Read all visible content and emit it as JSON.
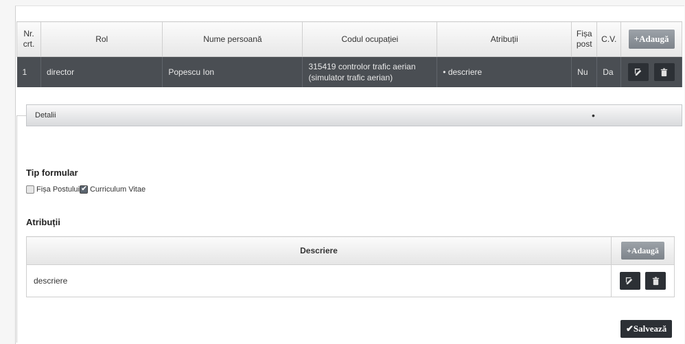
{
  "table": {
    "headers": {
      "nr": "Nr. crt.",
      "rol": "Rol",
      "nume": "Nume persoană",
      "cod": "Codul ocupației",
      "atributii": "Atribuții",
      "fisa": "Fișa post",
      "cv": "C.V."
    },
    "add_label": "+Adaugă",
    "rows": [
      {
        "nr": "1",
        "rol": "director",
        "nume": "Popescu Ion",
        "cod": "315419 controlor trafic aerian (simulator trafic aerian)",
        "atributii": "• descriere",
        "fisa": "Nu",
        "cv": "Da"
      }
    ]
  },
  "details": {
    "bar_label": "Detalii",
    "tip_formular_title": "Tip formular",
    "options": [
      {
        "label": "Fișa Postului",
        "checked": false
      },
      {
        "label": "Curriculum Vitae",
        "checked": true
      }
    ],
    "atributii_title": "Atribuții",
    "attr_table": {
      "header": "Descriere",
      "add_label": "+Adaugă",
      "rows": [
        {
          "descriere": "descriere"
        }
      ]
    },
    "save_label": "✔Salvează"
  },
  "icons": {
    "edit": "edit-icon",
    "delete": "trash-icon"
  },
  "colors": {
    "row_bg": "#4a4e53",
    "button_dark": "#2c3035",
    "button_gray": "#8a9096"
  }
}
